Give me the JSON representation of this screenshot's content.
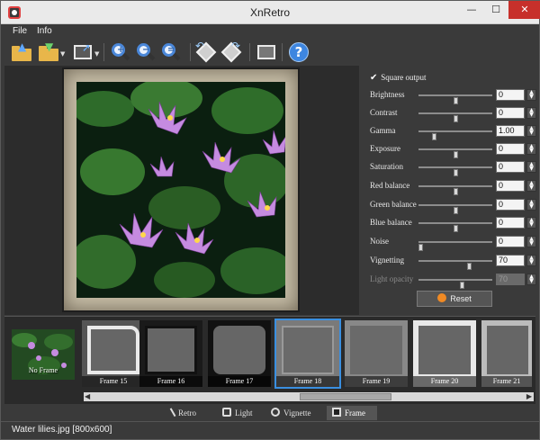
{
  "window": {
    "title": "XnRetro",
    "min_glyph": "—",
    "max_glyph": "☐",
    "close_glyph": "✕"
  },
  "menu": {
    "file": "File",
    "info": "Info"
  },
  "toolbar": {
    "icons": [
      "open-icon",
      "save-icon",
      "export-icon",
      "zoom-in-icon",
      "zoom-out-icon",
      "zoom-fit-icon",
      "rotate-left-icon",
      "rotate-right-icon",
      "settings-icon",
      "help-icon"
    ],
    "help_glyph": "?"
  },
  "panel": {
    "square_output": "Square output",
    "rows": [
      {
        "label": "Brightness",
        "value": "0",
        "level": 0.5
      },
      {
        "label": "Contrast",
        "value": "0",
        "level": 0.5
      },
      {
        "label": "Gamma",
        "value": "1.00",
        "level": 0.2
      },
      {
        "label": "Exposure",
        "value": "0",
        "level": 0.5
      },
      {
        "label": "Saturation",
        "value": "0",
        "level": 0.5
      },
      {
        "label": "Red balance",
        "value": "0",
        "level": 0.5
      },
      {
        "label": "Green balance",
        "value": "0",
        "level": 0.5
      },
      {
        "label": "Blue balance",
        "value": "0",
        "level": 0.5
      },
      {
        "label": "Noise",
        "value": "0",
        "level": 0.0
      },
      {
        "label": "Vignetting",
        "value": "70",
        "level": 0.7
      },
      {
        "label": "Light opacity",
        "value": "70",
        "level": 0.6,
        "disabled": true
      }
    ],
    "reset": "Reset"
  },
  "strip": {
    "no_frame": "No Frame",
    "frames": [
      "Frame 15",
      "Frame 16",
      "Frame 17",
      "Frame 18",
      "Frame 19",
      "Frame 20",
      "Frame 21"
    ],
    "selected": "Frame 18",
    "scroll_left": "◀",
    "scroll_right": "▶"
  },
  "tabs": [
    {
      "label": "Retro",
      "icon": "brush-icon"
    },
    {
      "label": "Light",
      "icon": "light-icon"
    },
    {
      "label": "Vignette",
      "icon": "vignette-icon"
    },
    {
      "label": "Frame",
      "icon": "frame-icon",
      "active": true
    }
  ],
  "status": "Water lilies.jpg [800x600]",
  "colors": {
    "accent": "#3a8fe0",
    "reset": "#f08a24",
    "background": "#3a3a3a"
  }
}
